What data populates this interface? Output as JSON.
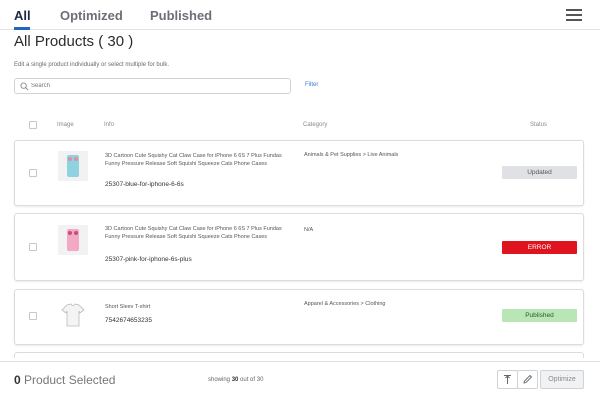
{
  "tabs": [
    {
      "label": "All",
      "active": true
    },
    {
      "label": "Optimized",
      "active": false
    },
    {
      "label": "Published",
      "active": false
    }
  ],
  "menu_icon": "hamburger-menu-icon",
  "page_title": "All Products ( 30 )",
  "subtitle": "Edit a single product individually or select multiple for bulk.",
  "search": {
    "placeholder": "Search",
    "icon": "search-icon"
  },
  "filter_label": "Filter",
  "columns": {
    "image": "Image",
    "info": "Info",
    "category": "Category",
    "status": "Status"
  },
  "products": [
    {
      "info": "3D Cartoon Cute Squishy Cat Claw Case for iPhone 6 6S 7 Plus Fundas Funny Pressure Release Soft Squishi Squeeze Cats Phone Cases",
      "sku": "25307-blue-for-iphone-6-6s",
      "category": "Animals & Pet Supplies > Live Animals",
      "status": "Updated",
      "status_color": "#dfe1e4"
    },
    {
      "info": "3D Cartoon Cute Squishy Cat Claw Case for iPhone 6 6S 7 Plus Fundas Funny Pressure Release Soft Squishi Squeeze Cats Phone Cases",
      "sku": "25307-pink-for-iphone-6s-plus",
      "category": "N/A",
      "status": "ERROR",
      "status_color": "#e0141e"
    },
    {
      "info": "Short Sleev T-shirt",
      "sku": "7542674653235",
      "category": "Apparel & Accessories > Clothing",
      "status": "Published",
      "status_color": "#b8e6b4"
    }
  ],
  "footer": {
    "selected_count": "0",
    "selected_label": "Product Selected",
    "showing_prefix": "showing",
    "showing_count": "30",
    "showing_suffix": "out of 30",
    "optimize_label": "Optimize",
    "tool_icons": [
      "upload-icon",
      "edit-pencil-icon"
    ]
  }
}
